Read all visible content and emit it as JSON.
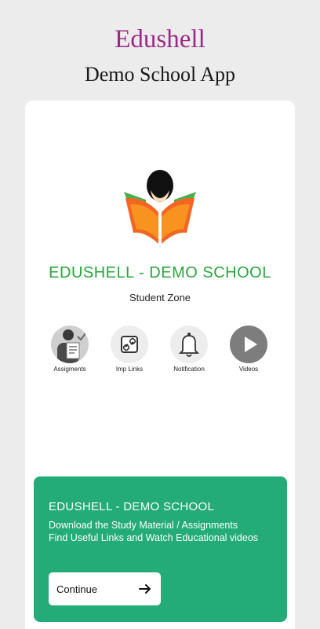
{
  "header": {
    "title": "Edushell",
    "subtitle": "Demo School App"
  },
  "card": {
    "logo_icon": "book-reader-logo-icon",
    "school_name": "EDUSHELL - DEMO SCHOOL",
    "zone_label": "Student Zone",
    "features": [
      {
        "label": "Assigments",
        "icon": "student-document-icon"
      },
      {
        "label": "Imp Links",
        "icon": "link-icon"
      },
      {
        "label": "Notification",
        "icon": "bell-icon"
      },
      {
        "label": "Videos",
        "icon": "play-icon"
      }
    ]
  },
  "banner": {
    "title": "EDUSHELL - DEMO SCHOOL",
    "line1": "Download the Study Material / Assignments",
    "line2": "Find Useful Links and Watch Educational videos",
    "button_label": "Continue",
    "button_icon": "arrow-right-icon"
  },
  "colors": {
    "title": "#9b2a86",
    "school_name": "#2aa63a",
    "banner": "#23ab78",
    "background": "#ececec"
  }
}
